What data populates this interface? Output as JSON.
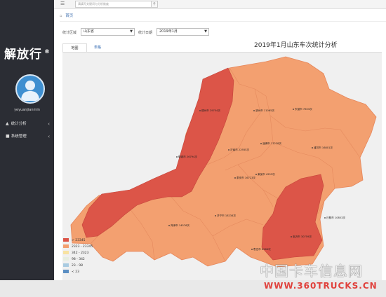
{
  "sidebar": {
    "logo_text": "解放行®",
    "username": "yeyuanjianmin",
    "items": [
      {
        "label": "统计分析",
        "icon": "chart-icon"
      },
      {
        "label": "系统管理",
        "icon": "settings-icon"
      }
    ]
  },
  "topbar": {
    "search_placeholder": "请填写关键词与分析维度"
  },
  "breadcrumb": {
    "label": "首页"
  },
  "filters": {
    "region_label": "统计区域",
    "region_value": "山东省",
    "month_label": "统计日期",
    "month_value": "2019年1月"
  },
  "tabs": [
    {
      "label": "地图",
      "active": true
    },
    {
      "label": "表格",
      "active": false
    }
  ],
  "chart": {
    "title": "2019年1月山东车次统计分析"
  },
  "map_labels": [
    "德州市 29754次",
    "滨州市 11065次",
    "东营市 7653次",
    "聊城市 26794次",
    "济南市 22935次",
    "淄博市 11228次",
    "潍坊市 16801次",
    "泰安市 16723次",
    "莱芜市 4253次",
    "济宁市 18234次",
    "日照市 10853次",
    "临沂市 30759次",
    "菏泽市 14576次",
    "枣庄市 6266次"
  ],
  "legend": [
    {
      "label": "> 23345",
      "color": "#dc5548"
    },
    {
      "label": "2323 - 23345",
      "color": "#f3a070"
    },
    {
      "label": "342 - 2323",
      "color": "#f8e3a2"
    },
    {
      "label": "98 - 342",
      "color": "#e7eee1"
    },
    {
      "label": "23 - 98",
      "color": "#a9cbe1"
    },
    {
      "label": "< 23",
      "color": "#5b8fc3"
    }
  ],
  "watermark": {
    "cn": "中国卡车信息网",
    "url": "WWW.360TRUCKS.CN"
  }
}
